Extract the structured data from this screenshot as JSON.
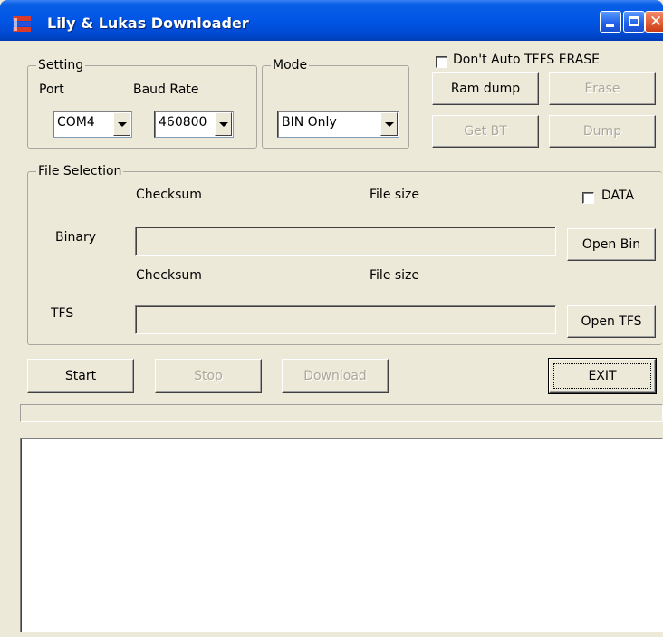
{
  "window": {
    "title": "Lily & Lukas Downloader"
  },
  "setting": {
    "legend": "Setting",
    "port_label": "Port",
    "baud_label": "Baud Rate",
    "port_value": "COM4",
    "baud_value": "460800"
  },
  "mode": {
    "legend": "Mode",
    "value": "BIN Only"
  },
  "options": {
    "dont_auto_erase_label": "Don't Auto TFFS ERASE",
    "dont_auto_erase_checked": false
  },
  "tools": {
    "ram_dump": "Ram dump",
    "erase": "Erase",
    "get_bt": "Get BT",
    "dump": "Dump"
  },
  "file_selection": {
    "legend": "File Selection",
    "checksum_label": "Checksum",
    "file_size_label": "File size",
    "data_label": "DATA",
    "data_checked": false,
    "binary_label": "Binary",
    "binary_path": "",
    "open_bin": "Open Bin",
    "tfs_label": "TFS",
    "tfs_path": "",
    "open_tfs": "Open TFS"
  },
  "actions": {
    "start": "Start",
    "stop": "Stop",
    "download": "Download",
    "exit": "EXIT"
  },
  "progress": 0,
  "log": ""
}
